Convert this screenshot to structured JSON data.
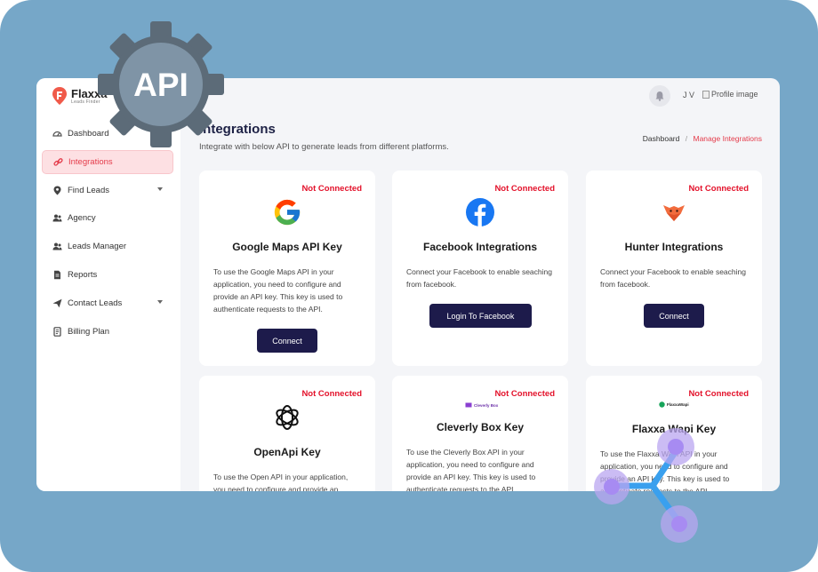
{
  "brand": {
    "name": "Flaxxa",
    "tagline": "Leads Finder"
  },
  "badge_text": "API",
  "sidebar": {
    "items": [
      {
        "label": "Dashboard",
        "icon": "dashboard-icon"
      },
      {
        "label": "Integrations",
        "icon": "link-icon",
        "active": true
      },
      {
        "label": "Find Leads",
        "icon": "location-pin-icon",
        "has_submenu": true
      },
      {
        "label": "Agency",
        "icon": "users-icon"
      },
      {
        "label": "Leads Manager",
        "icon": "users-icon"
      },
      {
        "label": "Reports",
        "icon": "document-icon"
      },
      {
        "label": "Contact Leads",
        "icon": "send-icon",
        "has_submenu": true
      },
      {
        "label": "Billing Plan",
        "icon": "receipt-icon"
      }
    ]
  },
  "header": {
    "user_initials": "J V",
    "profile_alt": "Profile image"
  },
  "page": {
    "title": "Integrations",
    "subtitle": "Integrate with below API to generate leads from different platforms."
  },
  "breadcrumb": {
    "home": "Dashboard",
    "separator": "/",
    "current": "Manage Integrations"
  },
  "cards": [
    {
      "status": "Not Connected",
      "icon": "google-icon",
      "title": "Google Maps API Key",
      "description": "To use the Google Maps API in your application, you need to configure and provide an API key. This key is used to authenticate requests to the API.",
      "button": "Connect"
    },
    {
      "status": "Not Connected",
      "icon": "facebook-icon",
      "title": "Facebook Integrations",
      "description": "Connect your Facebook to enable seaching from facebook.",
      "button": "Login To Facebook"
    },
    {
      "status": "Not Connected",
      "icon": "hunter-fox-icon",
      "title": "Hunter Integrations",
      "description": "Connect your Facebook to enable seaching from facebook.",
      "button": "Connect"
    },
    {
      "status": "Not Connected",
      "icon": "openai-icon",
      "title": "OpenApi Key",
      "description": "To use the Open API in your application, you need to configure and provide an"
    },
    {
      "status": "Not Connected",
      "icon": "cleverly-box-logo",
      "logo_text": "Cleverly Box",
      "title": "Cleverly Box Key",
      "description": "To use the Cleverly Box API in your application, you need to configure and provide an API key. This key is used to authenticate requests to the API."
    },
    {
      "status": "Not Connected",
      "icon": "flaxxa-wapi-logo",
      "logo_text": "FlaxxaWapi",
      "title": "Flaxxa Wapi Key",
      "description": "To use the Flaxxa Wapi API in your application, you need to configure and provide an API key. This key is used to authenticate requests to the API."
    }
  ],
  "colors": {
    "background": "#76a7c8",
    "accent": "#e43b4a",
    "primary_button": "#1d1b4b",
    "status_red": "#e3112a",
    "gear": "#7f94a6"
  }
}
